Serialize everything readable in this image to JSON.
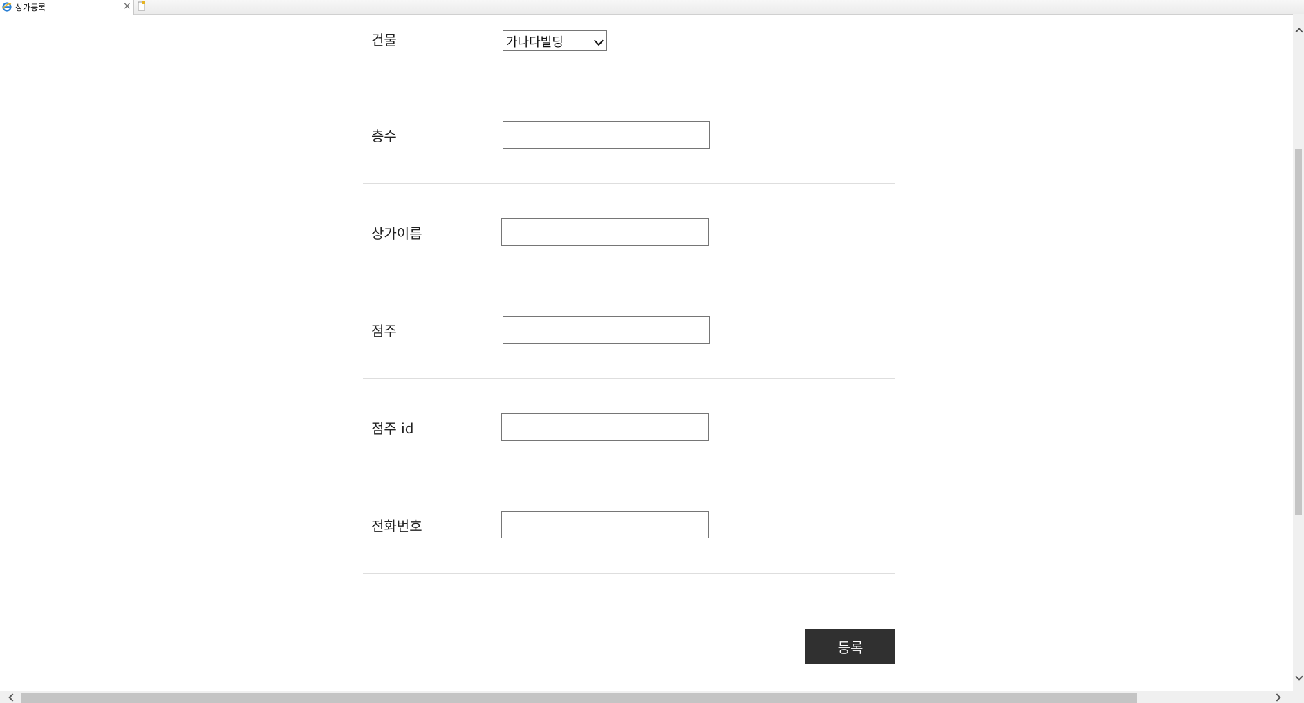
{
  "browser": {
    "tab_title": "상가등록",
    "tab_close": "×",
    "icon": "ie-icon",
    "new_tab_icon": "new-tab-icon"
  },
  "form": {
    "building": {
      "label": "건물",
      "selected": "가나다빌딩"
    },
    "floor": {
      "label": "층수",
      "value": ""
    },
    "store_name": {
      "label": "상가이름",
      "value": ""
    },
    "owner": {
      "label": "점주",
      "value": ""
    },
    "owner_id": {
      "label": "점주 id",
      "value": ""
    },
    "phone": {
      "label": "전화번호",
      "value": ""
    },
    "submit_label": "등록"
  },
  "colors": {
    "submit_bg": "#303030",
    "divider": "#dedede"
  }
}
